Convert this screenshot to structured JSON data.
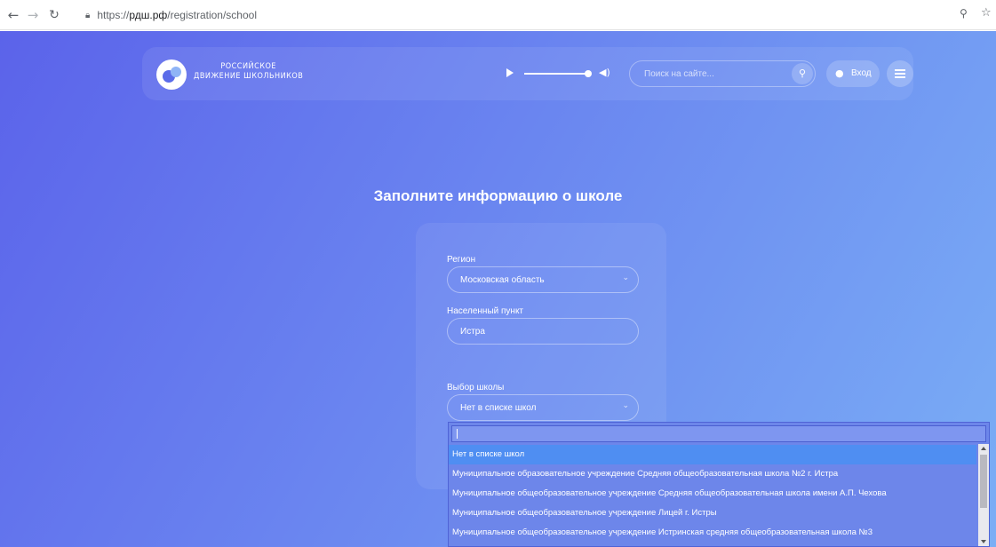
{
  "browser": {
    "url_prefix": "https://",
    "url_host": "рдш.рф",
    "url_path": "/registration/school",
    "icons": [
      "back-icon",
      "forward-icon",
      "reload-icon",
      "lock-icon",
      "zoom-icon",
      "star-icon"
    ]
  },
  "header": {
    "logo_line1": "РОССИЙСКОЕ",
    "logo_line2": "ДВИЖЕНИЕ ШКОЛЬНИКОВ",
    "search_placeholder": "Поиск на сайте...",
    "login_label": "Вход"
  },
  "form": {
    "title": "Заполните информацию о школе",
    "region_label": "Регион",
    "region_value": "Московская область",
    "city_label": "Населенный пункт",
    "city_value": "Истра",
    "school_label": "Выбор школы",
    "school_value": "Нет в списке школ"
  },
  "dropdown": {
    "search_value": "",
    "items": [
      "Нет в списке школ",
      "Муниципальное образовательное учреждение Средняя общеобразовательная школа №2 г. Истра",
      "Муниципальное общеобразовательное учреждение Средняя общеобразовательная школа имени А.П. Чехова",
      "Муниципальное общеобразовательное учреждение Лицей г. Истры",
      "Муниципальное общеобразовательное учреждение Истринская средняя общеобразовательная школа №3"
    ],
    "selected_index": 0
  },
  "colors": {
    "gradient_start": "#5b63ea",
    "gradient_end": "#7aaef5",
    "dropdown_bg": "#6d86ea",
    "dropdown_active": "#4f8ef2"
  }
}
